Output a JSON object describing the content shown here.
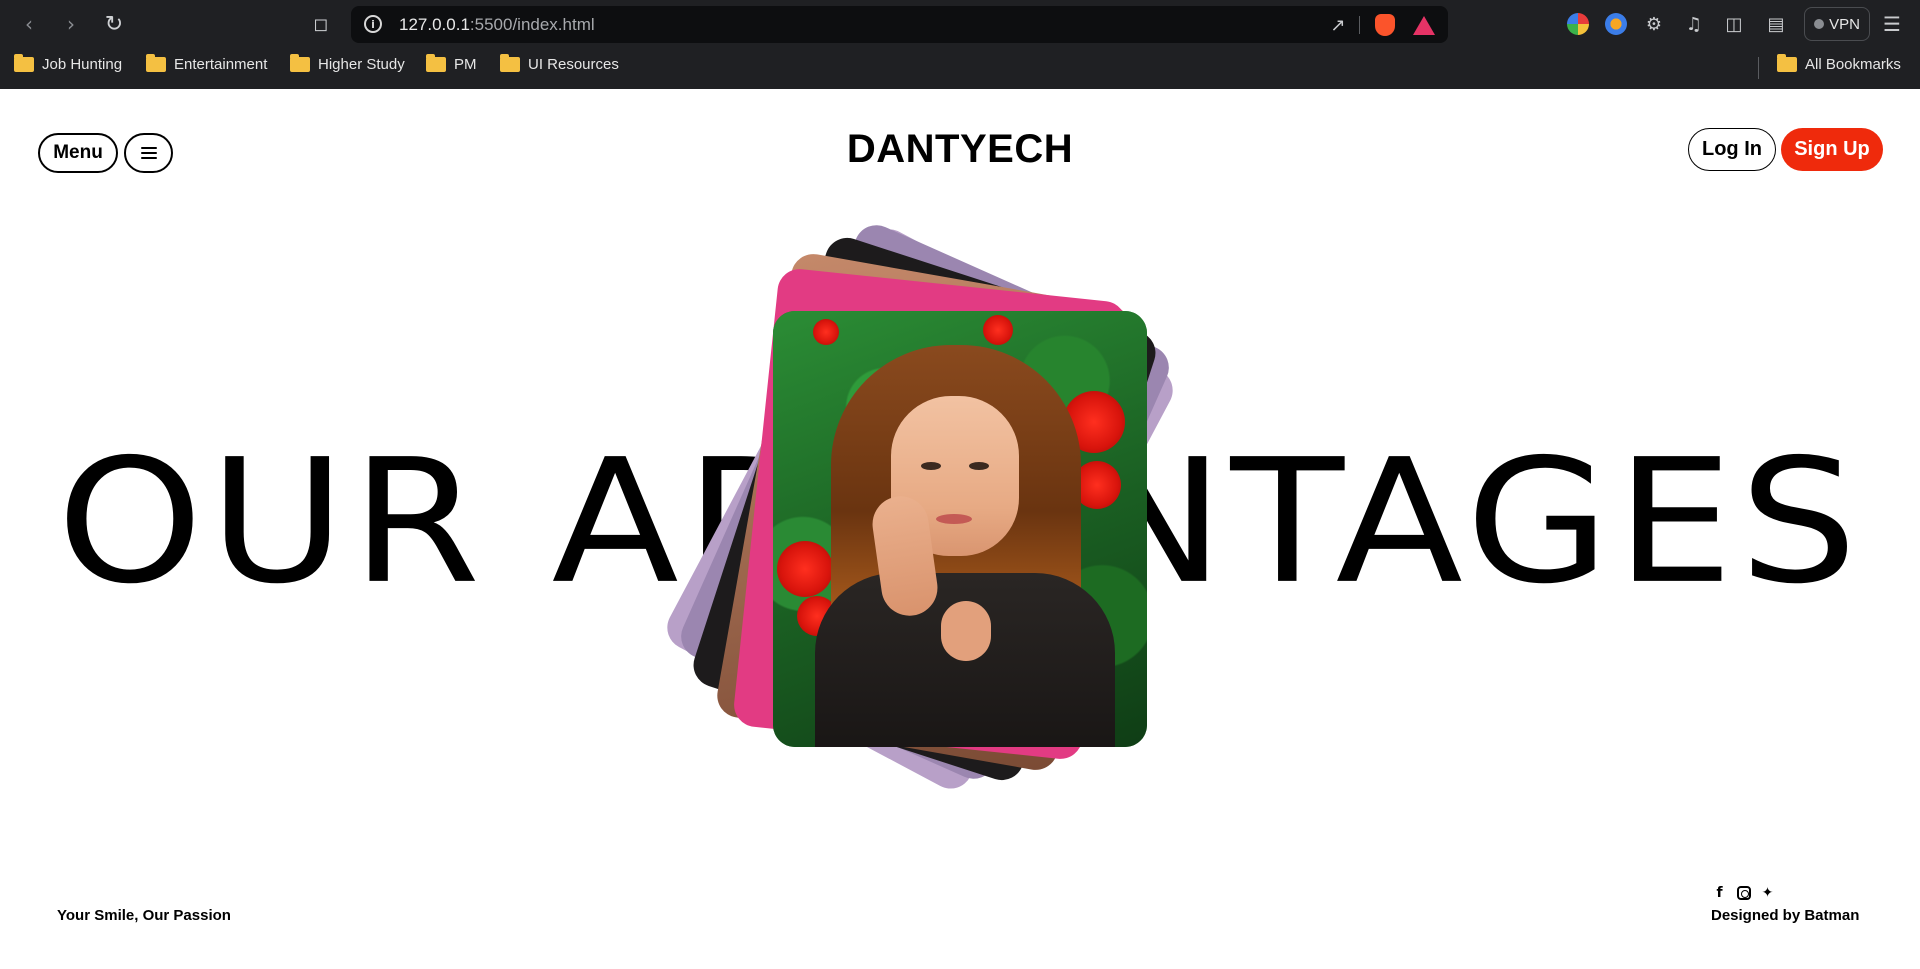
{
  "browser": {
    "url_host": "127.0.0.1",
    "url_rest": ":5500/index.html",
    "vpn_label": "VPN",
    "bookmarks": [
      "Job Hunting",
      "Entertainment",
      "Higher Study",
      "PM",
      "UI Resources"
    ],
    "all_bookmarks_label": "All Bookmarks"
  },
  "header": {
    "menu_label": "Menu",
    "brand": "DANTYECH",
    "login_label": "Log In",
    "signup_label": "Sign Up"
  },
  "hero": {
    "headline_left": "OUR AD",
    "headline_right": "VANTAGES",
    "headline_full": "OUR ADVANTAGES"
  },
  "footer": {
    "tagline": "Your Smile, Our Passion",
    "credit": "Designed by Batman",
    "social_icons": [
      "facebook-icon",
      "instagram-icon",
      "twitter-icon"
    ]
  },
  "colors": {
    "accent": "#ef2a0c",
    "chrome_bg": "#1f2023"
  }
}
